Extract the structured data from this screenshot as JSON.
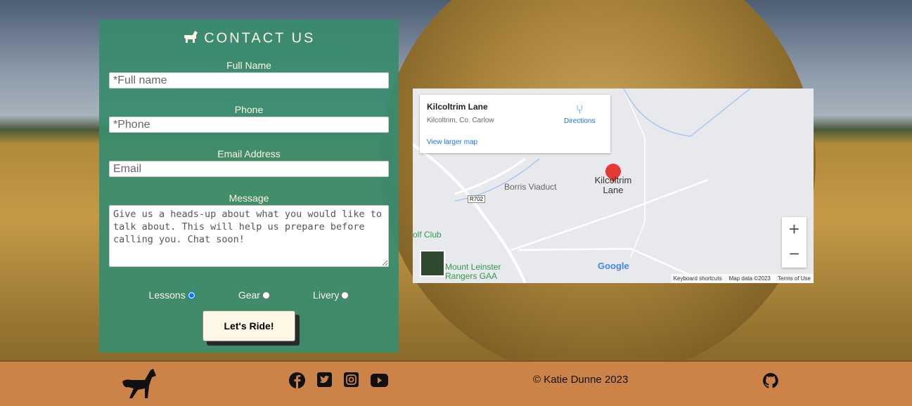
{
  "form": {
    "title": "CONTACT US",
    "title_icon": "horse-icon",
    "fields": [
      {
        "label": "Full Name",
        "placeholder": "*Full name"
      },
      {
        "label": "Phone",
        "placeholder": "*Phone"
      },
      {
        "label": "Email Address",
        "placeholder": "Email"
      }
    ],
    "message": {
      "label": "Message",
      "placeholder": "Give us a heads-up about what you would like to talk about. This will help us prepare before calling you. Chat soon!"
    },
    "options": [
      {
        "label": "Lessons",
        "selected": true
      },
      {
        "label": "Gear",
        "selected": false
      },
      {
        "label": "Livery",
        "selected": false
      }
    ],
    "submit": "Let's Ride!"
  },
  "map": {
    "place": "Kilcoltrim Lane",
    "address": "Kilcoltrim, Co. Carlow",
    "directions": "Directions",
    "larger": "View larger map",
    "marker_label_1": "Kilcoltrim",
    "marker_label_2": "Lane",
    "labels": {
      "viaduct": "Borris Viaduct",
      "road": "R702",
      "golf": "olf Club",
      "gaa1": "Mount Leinster",
      "gaa2": "Rangers GAA"
    },
    "zoom_in": "+",
    "zoom_out": "−",
    "keyboard": "Keyboard shortcuts",
    "mapdata": "Map data ©2023",
    "terms": "Terms of Use",
    "logo": "Google"
  },
  "footer": {
    "copyright": "© Katie Dunne 2023",
    "social": [
      "facebook-icon",
      "twitter-icon",
      "instagram-icon",
      "youtube-icon"
    ],
    "github": "github-icon"
  },
  "colors": {
    "form_bg": "#388c6e",
    "footer_bg": "#cb8348",
    "button_bg": "#fff8e6"
  }
}
